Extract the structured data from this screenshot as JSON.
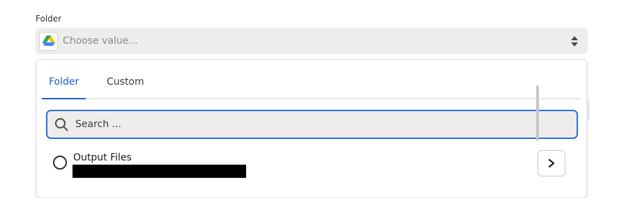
{
  "field": {
    "label": "Folder",
    "placeholder": "Choose value...",
    "app_icon": "google-drive-icon"
  },
  "dropdown": {
    "tabs": [
      {
        "label": "Folder",
        "active": true
      },
      {
        "label": "Custom",
        "active": false
      }
    ],
    "search": {
      "placeholder": "Search ..."
    },
    "items": [
      {
        "title": "Output Files",
        "subtitle_redacted": true
      }
    ]
  },
  "colors": {
    "accent": "#1f5ad3",
    "search_border": "#2a6fd8",
    "field_bg": "#eeedec"
  }
}
